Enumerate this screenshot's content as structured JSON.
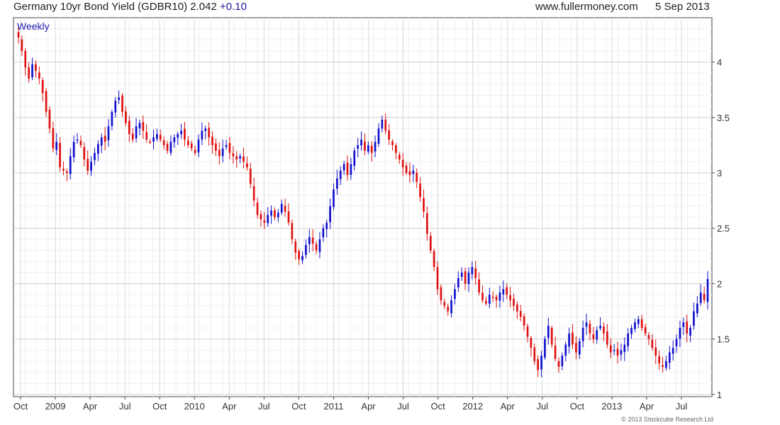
{
  "header": {
    "instrument": "Germany 10yr Bond Yield (GDBR10)",
    "last": "2.042",
    "change": "+0.10",
    "website": "www.fullermoney.com",
    "date": "5 Sep 2013"
  },
  "chart_data": {
    "type": "candlestick",
    "period_label": "Weekly",
    "x_tick_labels": [
      "Oct",
      "2009",
      "Apr",
      "Jul",
      "Oct",
      "2010",
      "Apr",
      "Jul",
      "Oct",
      "2011",
      "Apr",
      "Jul",
      "Oct",
      "2012",
      "Apr",
      "Jul",
      "Oct",
      "2013",
      "Apr",
      "Jul"
    ],
    "y_ticks": [
      1,
      1.5,
      2,
      2.5,
      3,
      3.5,
      4
    ],
    "y_tick_labels": [
      "1",
      "1.5",
      "2",
      "2.5",
      "3",
      "3.5",
      "4"
    ],
    "ylim": [
      0.98,
      4.4
    ],
    "grid": true,
    "up_color": "#1010d0",
    "down_color": "#e01010",
    "series_closes": [
      4.22,
      4.1,
      3.95,
      3.85,
      3.98,
      3.92,
      3.85,
      3.72,
      3.55,
      3.4,
      3.22,
      3.28,
      3.05,
      3.02,
      3.0,
      3.15,
      3.28,
      3.3,
      3.25,
      3.12,
      3.02,
      3.1,
      3.18,
      3.26,
      3.32,
      3.28,
      3.42,
      3.55,
      3.65,
      3.68,
      3.55,
      3.45,
      3.35,
      3.3,
      3.42,
      3.45,
      3.38,
      3.3,
      3.28,
      3.32,
      3.35,
      3.3,
      3.25,
      3.2,
      3.28,
      3.32,
      3.35,
      3.38,
      3.3,
      3.25,
      3.22,
      3.18,
      3.3,
      3.38,
      3.4,
      3.32,
      3.25,
      3.2,
      3.15,
      3.22,
      3.25,
      3.18,
      3.15,
      3.12,
      3.15,
      3.1,
      3.05,
      2.9,
      2.75,
      2.62,
      2.58,
      2.55,
      2.62,
      2.66,
      2.6,
      2.64,
      2.72,
      2.65,
      2.55,
      2.4,
      2.28,
      2.22,
      2.25,
      2.35,
      2.42,
      2.36,
      2.3,
      2.4,
      2.5,
      2.55,
      2.7,
      2.85,
      2.95,
      3.02,
      3.08,
      2.98,
      3.08,
      3.2,
      3.25,
      3.3,
      3.2,
      3.25,
      3.18,
      3.28,
      3.4,
      3.48,
      3.38,
      3.3,
      3.25,
      3.18,
      3.12,
      3.05,
      3.0,
      2.98,
      3.02,
      2.92,
      2.78,
      2.65,
      2.45,
      2.3,
      2.15,
      1.95,
      1.85,
      1.8,
      1.75,
      1.85,
      1.95,
      2.05,
      2.1,
      2.0,
      2.1,
      2.15,
      2.05,
      1.92,
      1.85,
      1.82,
      1.9,
      1.88,
      1.85,
      1.92,
      1.95,
      1.9,
      1.85,
      1.8,
      1.75,
      1.7,
      1.62,
      1.52,
      1.42,
      1.3,
      1.22,
      1.35,
      1.5,
      1.62,
      1.45,
      1.32,
      1.25,
      1.35,
      1.45,
      1.55,
      1.45,
      1.38,
      1.48,
      1.6,
      1.65,
      1.55,
      1.5,
      1.58,
      1.62,
      1.55,
      1.45,
      1.38,
      1.4,
      1.35,
      1.4,
      1.45,
      1.55,
      1.6,
      1.65,
      1.68,
      1.6,
      1.55,
      1.5,
      1.42,
      1.35,
      1.28,
      1.25,
      1.3,
      1.38,
      1.42,
      1.5,
      1.6,
      1.65,
      1.55,
      1.6,
      1.75,
      1.82,
      1.92,
      1.85,
      2.042
    ]
  },
  "credit": "© 2013 Stockcube Research Ltd"
}
